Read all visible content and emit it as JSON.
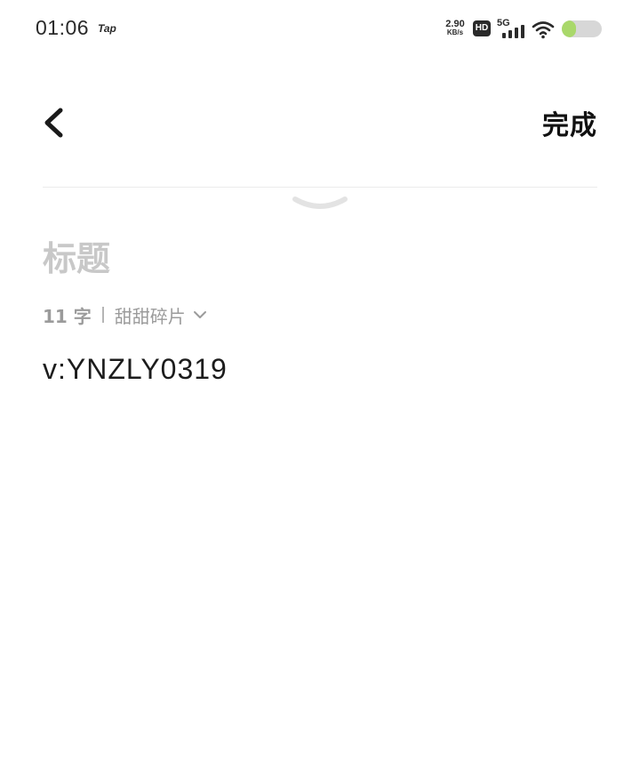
{
  "status_bar": {
    "time": "01:06",
    "notification_app": "Tap",
    "net_speed_value": "2.90",
    "net_speed_unit": "KB/s",
    "hd_label": "HD",
    "network_type": "5G",
    "battery_level": 0.35
  },
  "nav": {
    "done_label": "完成"
  },
  "note": {
    "title_placeholder": "标题",
    "char_count": "11 字",
    "folder_name": "甜甜碎片",
    "body": "v:YNZLY0319"
  },
  "colors": {
    "battery_fill": "#a9d86a",
    "battery_track": "#d7d7d7",
    "placeholder": "#c8c8c8",
    "meta_text": "#9b9b9b"
  }
}
